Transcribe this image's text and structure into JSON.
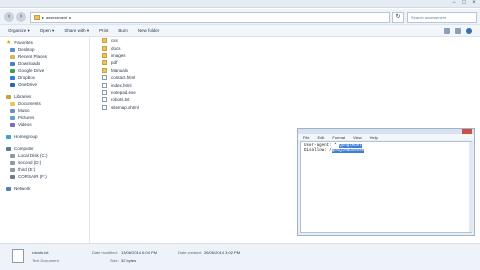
{
  "titlebar": {
    "minimize": "−",
    "maximize": "□",
    "close": "×"
  },
  "addressbar": {
    "back": "‹",
    "forward": "›",
    "path": "assessment",
    "separator": "▸",
    "refresh": "↻",
    "search_placeholder": "Search assessment"
  },
  "toolbar": {
    "organize": "Organize ▾",
    "open": "Open ▾",
    "share_with": "Share with ▾",
    "print": "Print",
    "burn": "Burn",
    "new_folder": "New folder"
  },
  "sidebar": {
    "favorites": {
      "label": "Favorites",
      "items": [
        "Desktop",
        "Recent Places",
        "Downloads",
        "Google Drive",
        "Dropbox",
        "OneDrive"
      ]
    },
    "libraries": {
      "label": "Libraries",
      "items": [
        "Documents",
        "Music",
        "Pictures",
        "Videos"
      ]
    },
    "homegroup": {
      "label": "Homegroup"
    },
    "computer": {
      "label": "Computer",
      "items": [
        "Local Disk (C:)",
        "second (D:)",
        "third (E:)",
        "CORSAIR (F:)"
      ]
    },
    "network": {
      "label": "Network"
    }
  },
  "files": [
    {
      "name": "css",
      "type": "folder"
    },
    {
      "name": "docs",
      "type": "folder"
    },
    {
      "name": "images",
      "type": "folder"
    },
    {
      "name": "pdf",
      "type": "folder"
    },
    {
      "name": "Manuals",
      "type": "folder"
    },
    {
      "name": "contact.html",
      "type": "doc"
    },
    {
      "name": "index.html",
      "type": "doc"
    },
    {
      "name": "notepad.exe",
      "type": "doc"
    },
    {
      "name": "robots.txt",
      "type": "doc"
    },
    {
      "name": "sitemap.xhtml",
      "type": "doc"
    }
  ],
  "notepad": {
    "menu": [
      "File",
      "Edit",
      "Format",
      "View",
      "Help"
    ],
    "line1": "User-agent: *",
    "line1_selected": "googlebot",
    "line2_prefix": "Disallow: /",
    "line2_selected": "googleadsense"
  },
  "statusbar": {
    "filename": "robots.txt",
    "filetype": "Text Document",
    "modified_label": "Date modified:",
    "modified_value": "13/06/2014 6:04 PM",
    "size_label": "Size:",
    "size_value": "32 bytes",
    "created_label": "Date created:",
    "created_value": "26/06/2014 3:02 PM"
  },
  "colors": {
    "folder": "#e8c463",
    "selection": "#3b7fd6",
    "accent": "#3b6fb1"
  }
}
